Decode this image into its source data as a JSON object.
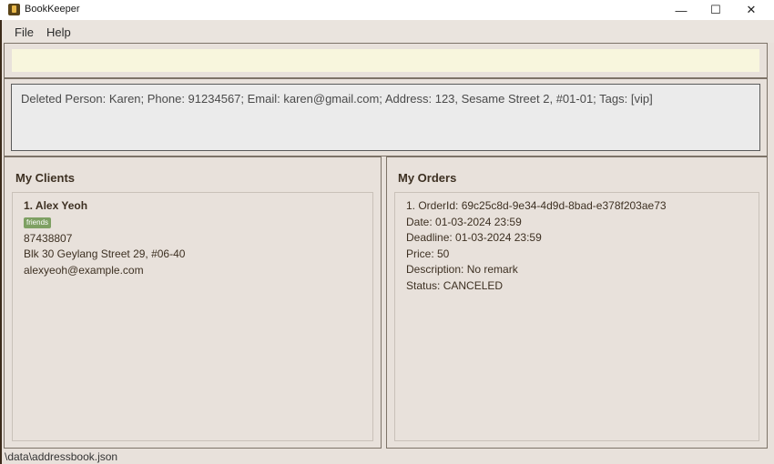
{
  "window": {
    "title": "BookKeeper",
    "controls": {
      "minimize": "—",
      "maximize": "☐",
      "close": "✕"
    }
  },
  "menu": {
    "file": "File",
    "help": "Help"
  },
  "command": {
    "value": "",
    "placeholder": ""
  },
  "result": {
    "text": "Deleted Person: Karen; Phone: 91234567; Email: karen@gmail.com; Address: 123, Sesame Street 2, #01-01; Tags: [vip]"
  },
  "clients": {
    "title": "My Clients",
    "items": [
      {
        "header": "1.  Alex Yeoh",
        "tag": "friends",
        "phone": "87438807",
        "address": "Blk 30 Geylang Street 29, #06-40",
        "email": "alexyeoh@example.com"
      }
    ]
  },
  "orders": {
    "title": "My Orders",
    "items": [
      {
        "header": "1.  OrderId: 69c25c8d-9e34-4d9d-8bad-e378f203ae73",
        "date": "Date: 01-03-2024 23:59",
        "deadline": "Deadline: 01-03-2024 23:59",
        "price": "Price: 50",
        "description": "Description: No remark",
        "status": "Status: CANCELED"
      }
    ]
  },
  "status_bar": {
    "path": "\\data\\addressbook.json"
  }
}
